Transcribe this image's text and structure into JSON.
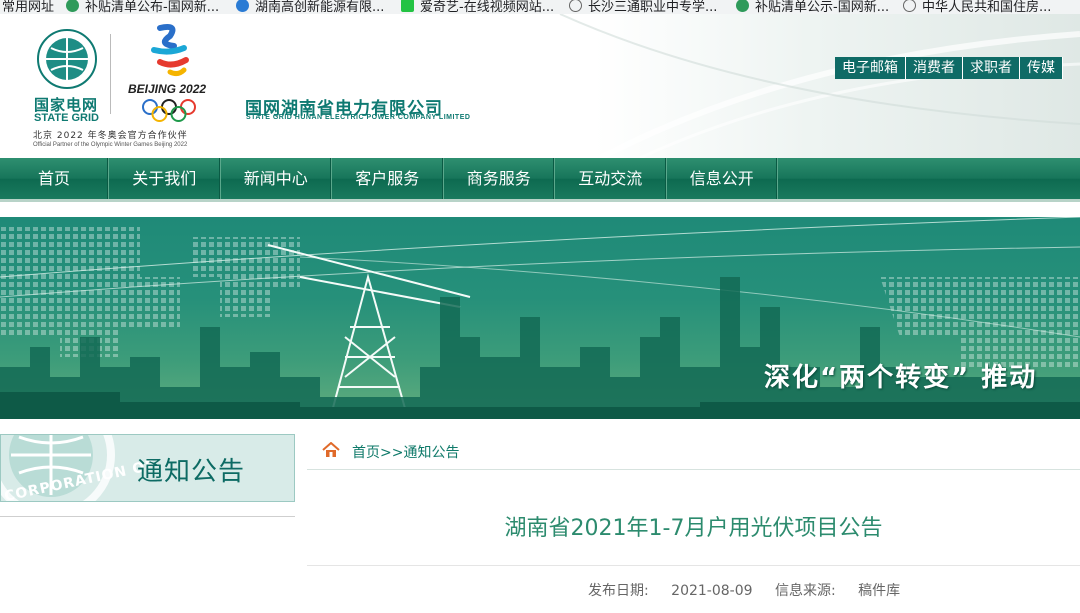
{
  "bookmarks": [
    {
      "label": "常用网址"
    },
    {
      "label": "补贴清单公布-国网新..."
    },
    {
      "label": "湖南高创新能源有限..."
    },
    {
      "label": "爱奇艺-在线视频网站..."
    },
    {
      "label": "长沙三通职业中专学..."
    },
    {
      "label": "补贴清单公示-国网新..."
    },
    {
      "label": "中华人民共和国住房..."
    }
  ],
  "header": {
    "state_grid_cn": "国家电网",
    "state_grid_en": "STATE GRID",
    "beijing_text": "BEIJING 2022",
    "partner_cn": "北京 2022 年冬奥会官方合作伙伴",
    "partner_en": "Official Partner of the Olympic Winter Games Beijing 2022",
    "company_cn": "国网湖南省电力有限公司",
    "company_en": "STATE GRID HUNAN ELECTRIC POWER COMPANY LIMITED",
    "toplinks": [
      "电子邮箱",
      "消费者",
      "求职者",
      "传媒"
    ]
  },
  "nav": [
    "首页",
    "关于我们",
    "新闻中心",
    "客户服务",
    "商务服务",
    "互动交流",
    "信息公开"
  ],
  "banner": {
    "slogan": "深化“两个转变” 推动"
  },
  "sidebar": {
    "title": "通知公告",
    "globe_text": "CORPORATION OF"
  },
  "breadcrumb": {
    "text": "首页>>通知公告"
  },
  "article": {
    "title": "湖南省2021年1-7月户用光伏项目公告",
    "date_label": "发布日期:",
    "date": "2021-08-09",
    "source_label": "信息来源:",
    "source": "稿件库"
  },
  "colors": {
    "brand": "#0f7a72",
    "nav": "#17755a",
    "title": "#2c8b6e"
  }
}
